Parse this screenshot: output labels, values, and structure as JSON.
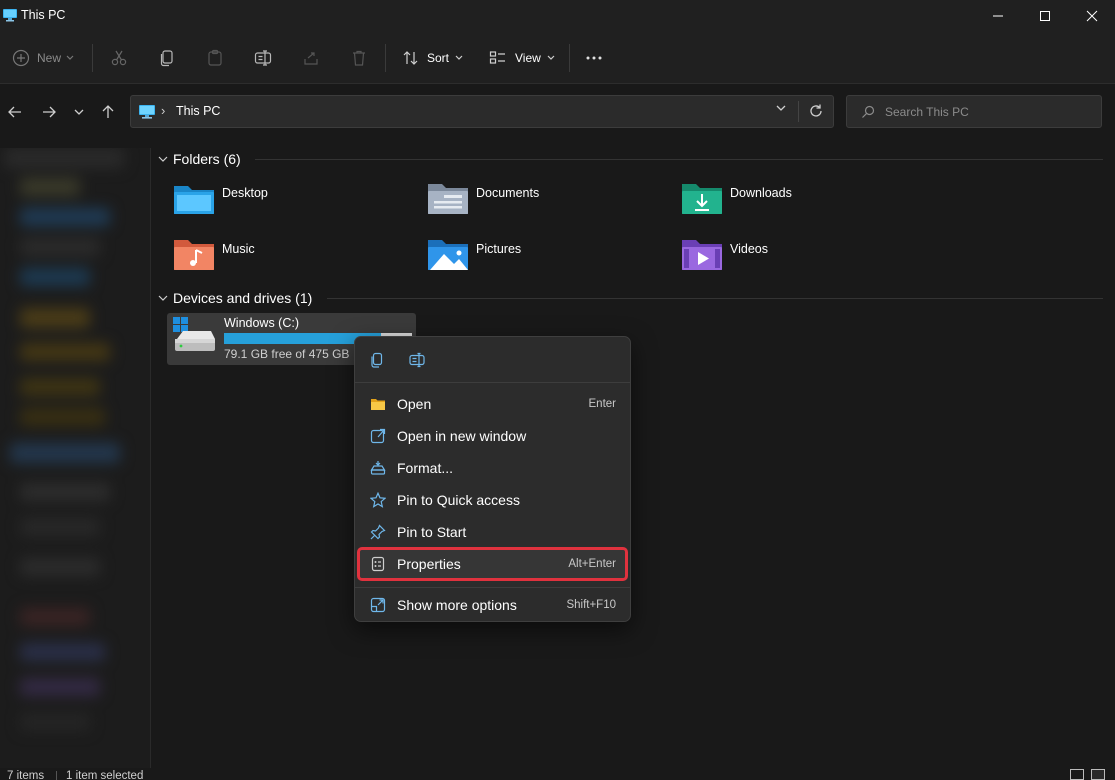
{
  "window": {
    "title": "This PC"
  },
  "toolbar": {
    "new_label": "New",
    "sort_label": "Sort",
    "view_label": "View"
  },
  "address": {
    "crumb": "This PC"
  },
  "search": {
    "placeholder": "Search This PC"
  },
  "sections": {
    "folders": {
      "title": "Folders (6)",
      "items": [
        {
          "name": "Desktop",
          "icon": "desktop-folder-icon",
          "color": "#2aa3e8"
        },
        {
          "name": "Documents",
          "icon": "documents-folder-icon",
          "color": "#9aa8bd"
        },
        {
          "name": "Downloads",
          "icon": "downloads-folder-icon",
          "color": "#1fae8a"
        },
        {
          "name": "Music",
          "icon": "music-folder-icon",
          "color": "#f07a55"
        },
        {
          "name": "Pictures",
          "icon": "pictures-folder-icon",
          "color": "#2b8fe0"
        },
        {
          "name": "Videos",
          "icon": "videos-folder-icon",
          "color": "#8e5bd6"
        }
      ]
    },
    "devices": {
      "title": "Devices and drives (1)",
      "drive": {
        "name": "Windows (C:)",
        "free": "79.1 GB free of 475 GB",
        "used_fraction": 0.833
      }
    }
  },
  "context_menu": {
    "items": [
      {
        "label": "Open",
        "shortcut": "Enter",
        "icon": "folder-open-icon"
      },
      {
        "label": "Open in new window",
        "shortcut": "",
        "icon": "open-new-window-icon"
      },
      {
        "label": "Format...",
        "shortcut": "",
        "icon": "format-drive-icon"
      },
      {
        "label": "Pin to Quick access",
        "shortcut": "",
        "icon": "star-icon"
      },
      {
        "label": "Pin to Start",
        "shortcut": "",
        "icon": "pin-icon"
      },
      {
        "label": "Properties",
        "shortcut": "Alt+Enter",
        "icon": "properties-icon"
      },
      {
        "label": "Show more options",
        "shortcut": "Shift+F10",
        "icon": "more-options-icon"
      }
    ]
  },
  "statusbar": {
    "count": "7 items",
    "selected": "1 item selected"
  },
  "colors": {
    "accent": "#26a0da",
    "highlight_outline": "#e0323e",
    "background": "#191919"
  }
}
